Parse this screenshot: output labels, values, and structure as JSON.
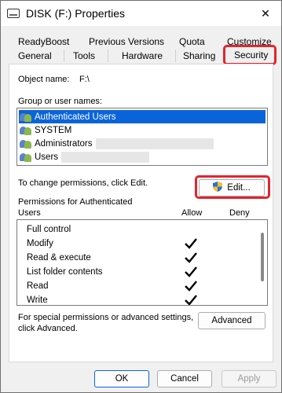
{
  "window": {
    "title": "DISK (F:) Properties",
    "close_symbol": "✕"
  },
  "tabs": {
    "row1": [
      "ReadyBoost",
      "Previous Versions",
      "Quota",
      "Customize"
    ],
    "row2": [
      "General",
      "Tools",
      "Hardware",
      "Sharing",
      "Security"
    ],
    "active": "Security"
  },
  "security": {
    "object_name_label": "Object name:",
    "object_name_value": "F:\\",
    "group_label": "Group or user names:",
    "users": [
      {
        "name": "Authenticated Users",
        "selected": true
      },
      {
        "name": "SYSTEM",
        "selected": false
      },
      {
        "name": "Administrators",
        "selected": false
      },
      {
        "name": "Users",
        "selected": false
      }
    ],
    "change_text": "To change permissions, click Edit.",
    "edit_button": "Edit...",
    "permissions_label_line1": "Permissions for Authenticated",
    "permissions_label_line2": "Users",
    "allow_header": "Allow",
    "deny_header": "Deny",
    "permissions": [
      {
        "name": "Full control",
        "allow": false,
        "deny": false
      },
      {
        "name": "Modify",
        "allow": true,
        "deny": false
      },
      {
        "name": "Read & execute",
        "allow": true,
        "deny": false
      },
      {
        "name": "List folder contents",
        "allow": true,
        "deny": false
      },
      {
        "name": "Read",
        "allow": true,
        "deny": false
      },
      {
        "name": "Write",
        "allow": true,
        "deny": false
      }
    ],
    "advanced_text_line1": "For special permissions or advanced settings,",
    "advanced_text_line2": "click Advanced.",
    "advanced_button": "Advanced"
  },
  "footer": {
    "ok": "OK",
    "cancel": "Cancel",
    "apply": "Apply"
  },
  "colors": {
    "selection": "#0a64d9",
    "highlight": "#e0262f"
  }
}
